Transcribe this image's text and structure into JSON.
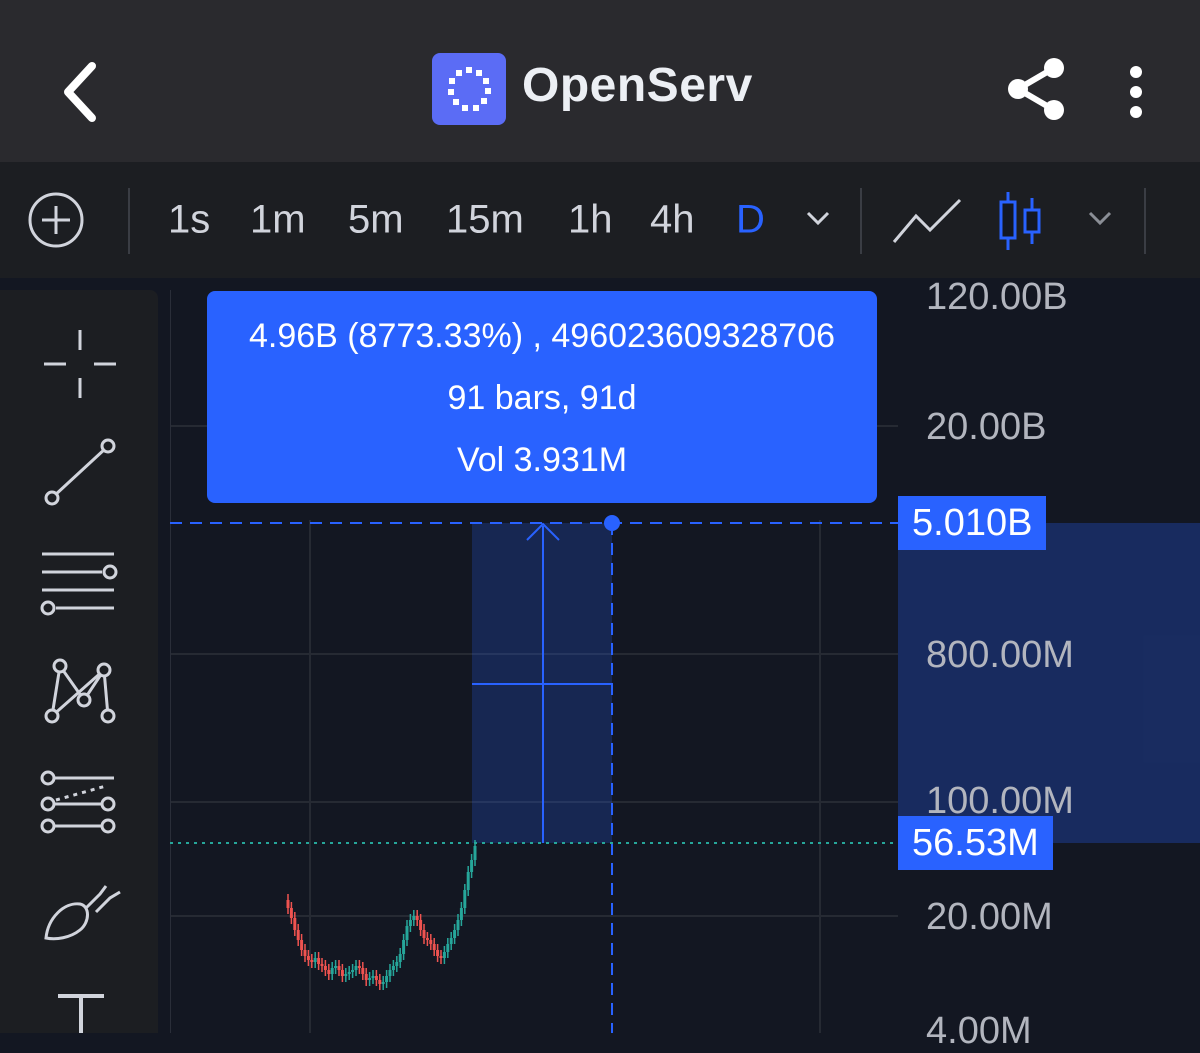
{
  "app": {
    "title": "OpenServ"
  },
  "topbar": {
    "back_icon": "chevron-left-icon",
    "logo_icon": "openserv-logo-icon",
    "share_icon": "share-icon",
    "menu_icon": "more-vertical-icon"
  },
  "toolbar": {
    "add_icon": "plus-circle-icon",
    "intervals": [
      "1s",
      "1m",
      "5m",
      "15m",
      "1h",
      "4h",
      "D"
    ],
    "selected_interval": "D",
    "line_icon": "line-chart-icon",
    "candle_icon": "candlestick-icon",
    "dropdown_icon": "chevron-down-icon"
  },
  "sidebar": {
    "tools": [
      "crosshair-icon",
      "trend-line-icon",
      "fib-retracement-icon",
      "pattern-icon",
      "forecast-icon",
      "brush-icon",
      "text-icon"
    ]
  },
  "tooltip": {
    "line1": "4.96B (8773.33%) , 496023609328706",
    "line2": "91 bars, 91d",
    "line3": "Vol 3.931M"
  },
  "price_scale": {
    "labels": [
      "120.00B",
      "20.00B",
      "800.00M",
      "100.00M",
      "20.00M",
      "4.00M"
    ],
    "upper_badge": "5.010B",
    "lower_badge": "56.53M"
  },
  "colors": {
    "accent": "#2962ff",
    "up": "#26a69a",
    "down": "#ef5350",
    "background": "#131722"
  }
}
